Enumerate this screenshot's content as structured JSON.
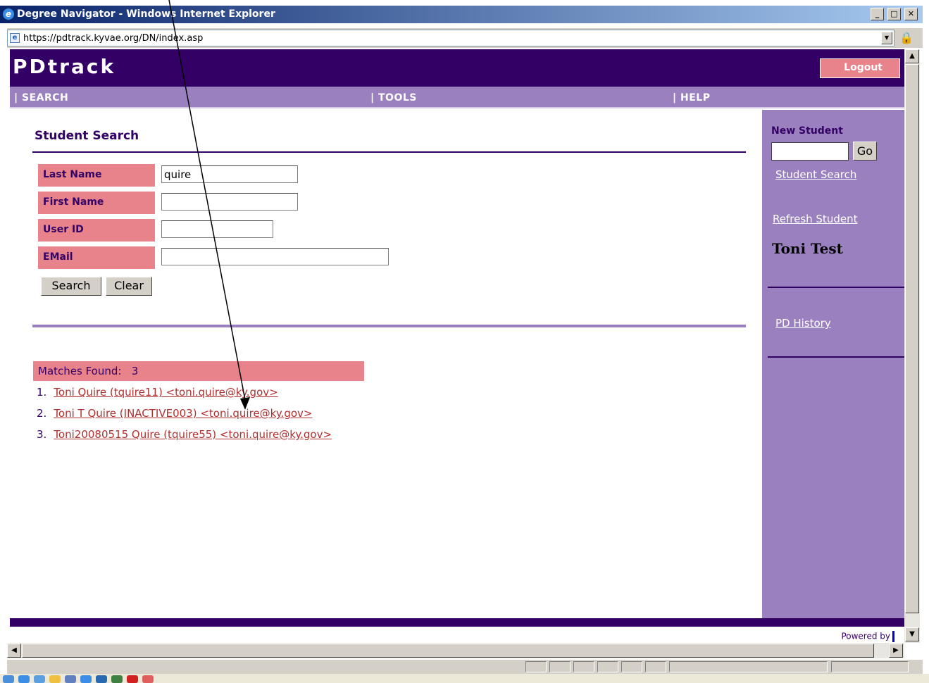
{
  "window": {
    "title": "Degree Navigator - Windows Internet Explorer",
    "url": "https://pdtrack.kyvae.org/DN/index.asp"
  },
  "header": {
    "logo": "PDtrack",
    "logout_label": "Logout"
  },
  "nav": {
    "items": [
      {
        "label": "| SEARCH"
      },
      {
        "label": "| TOOLS"
      },
      {
        "label": "| HELP"
      }
    ]
  },
  "search": {
    "title": "Student Search",
    "fields": [
      {
        "label": "Last Name",
        "value": "quire"
      },
      {
        "label": "First Name",
        "value": ""
      },
      {
        "label": "User ID",
        "value": ""
      },
      {
        "label": "EMail",
        "value": ""
      }
    ],
    "search_label": "Search",
    "clear_label": "Clear"
  },
  "results": {
    "matches_label": "Matches Found:",
    "matches_count": "3",
    "items": [
      {
        "num": "1.",
        "text": "Toni Quire (tquire11) <toni.quire@ky.gov>"
      },
      {
        "num": "2.",
        "text": "Toni T Quire (INACTIVE003) <toni.quire@ky.gov>"
      },
      {
        "num": "3.",
        "text": "Toni20080515 Quire (tquire55) <toni.quire@ky.gov>"
      }
    ]
  },
  "sidebar": {
    "new_student_label": "New Student",
    "new_student_value": "",
    "go_label": "Go",
    "student_search_link": "Student Search",
    "refresh_student_link": "Refresh Student",
    "student_name": "Toni Test",
    "pd_history_link": "PD History"
  },
  "footer": {
    "powered_by": "Powered by"
  },
  "colors": {
    "header": "#330066",
    "nav": "#9b80c0",
    "label_bg": "#e8838c",
    "link": "#b03030"
  }
}
